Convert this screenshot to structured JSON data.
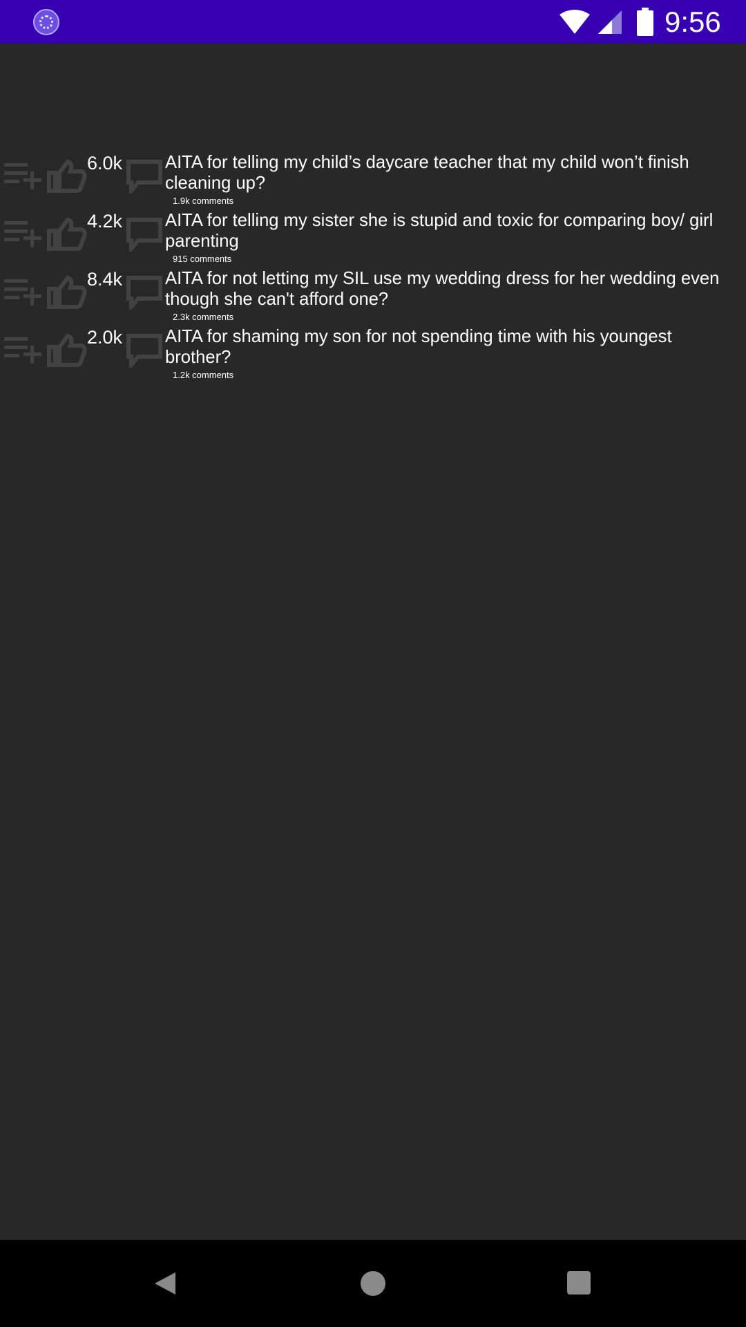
{
  "status_bar": {
    "time": "9:56",
    "icons": [
      "app-notification-icon",
      "wifi-icon",
      "signal-icon",
      "battery-icon"
    ]
  },
  "posts": [
    {
      "score": "6.0k",
      "title": "AITA for telling my child’s daycare teacher that my child won’t finish cleaning up?",
      "comments": "1.9k comments"
    },
    {
      "score": "4.2k",
      "title": "AITA for telling my sister she is stupid and toxic for comparing boy/ girl parenting",
      "comments": "915 comments"
    },
    {
      "score": "8.4k",
      "title": "AITA for not letting my SIL use my wedding dress for her wedding even though she can't afford one?",
      "comments": "2.3k comments"
    },
    {
      "score": "2.0k",
      "title": "AITA for shaming my son for not spending time with his youngest brother?",
      "comments": "1.2k comments"
    }
  ],
  "post_action_icons": [
    "playlist-add-icon",
    "thumb-up-icon",
    "comment-icon"
  ],
  "nav_bar": {
    "icons": [
      "back-icon",
      "home-icon",
      "recents-icon"
    ]
  },
  "colors": {
    "status_bar": "#3700b3",
    "background": "#282828",
    "nav_bar": "#000000",
    "text": "#ffffff"
  }
}
